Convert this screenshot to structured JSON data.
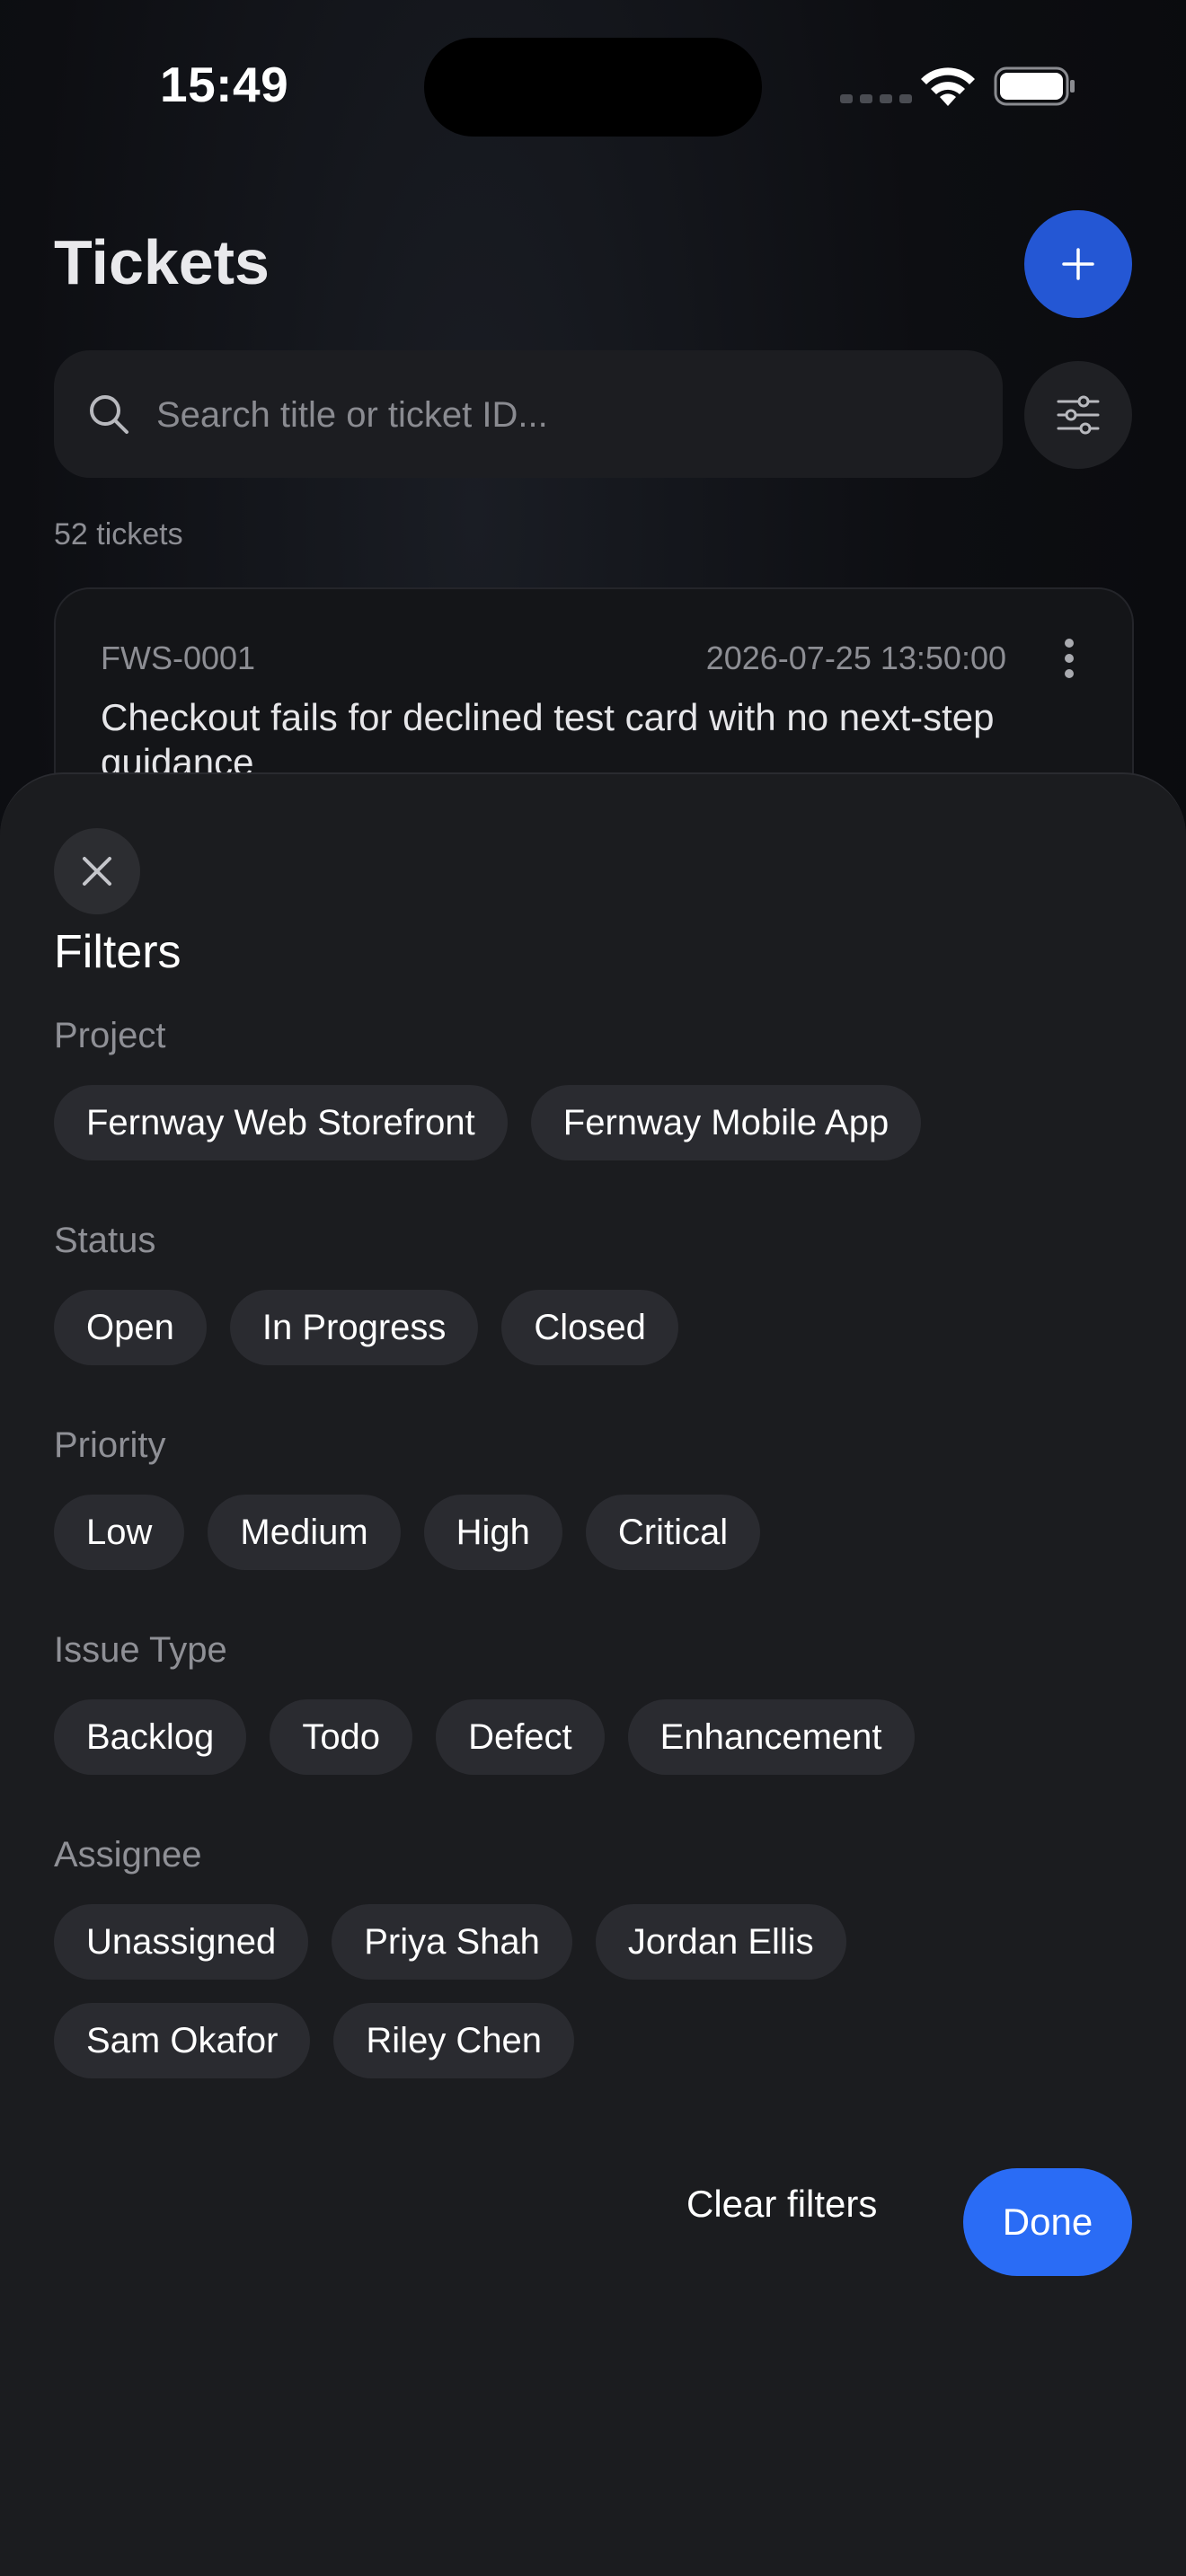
{
  "status_bar": {
    "time": "15:49"
  },
  "header": {
    "title": "Tickets",
    "add_icon": "plus-icon"
  },
  "search": {
    "placeholder": "Search title or ticket ID...",
    "value": "",
    "icon": "search-icon",
    "filter_icon": "sliders-icon"
  },
  "ticket_count": "52 tickets",
  "tickets": [
    {
      "id": "FWS-0001",
      "date": "2026-07-25 13:50:00",
      "title": "Checkout fails for declined test card with no next-step guidance"
    }
  ],
  "filters": {
    "title": "Filters",
    "close_icon": "close-icon",
    "sections": {
      "project": {
        "label": "Project",
        "options": [
          "Fernway Web Storefront",
          "Fernway Mobile App"
        ]
      },
      "status": {
        "label": "Status",
        "options": [
          "Open",
          "In Progress",
          "Closed"
        ]
      },
      "priority": {
        "label": "Priority",
        "options": [
          "Low",
          "Medium",
          "High",
          "Critical"
        ]
      },
      "issue_type": {
        "label": "Issue Type",
        "options": [
          "Backlog",
          "Todo",
          "Defect",
          "Enhancement"
        ]
      },
      "assignee": {
        "label": "Assignee",
        "options": [
          "Unassigned",
          "Priya Shah",
          "Jordan Ellis",
          "Sam Okafor",
          "Riley Chen"
        ]
      }
    },
    "clear_label": "Clear filters",
    "done_label": "Done"
  },
  "colors": {
    "accent": "#2a6cf5",
    "add_button": "#2457d4",
    "sheet_bg": "#1b1c1f",
    "chip_bg": "#2a2b30"
  }
}
